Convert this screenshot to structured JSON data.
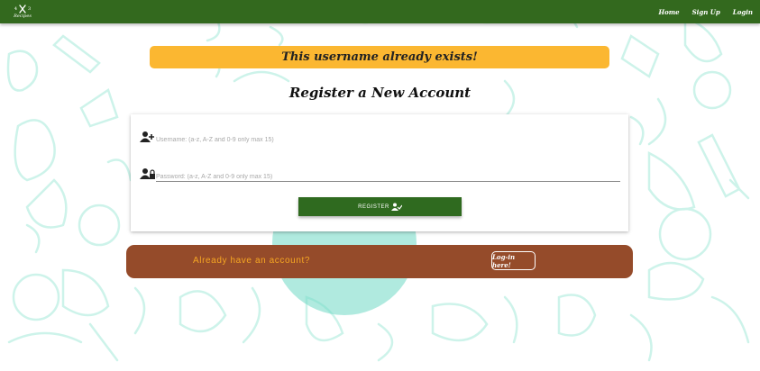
{
  "brand": {
    "number_left": "4",
    "number_right": "3",
    "name": "Recipes"
  },
  "nav": {
    "items": [
      {
        "label": "Home"
      },
      {
        "label": "Sign Up"
      },
      {
        "label": "Login"
      }
    ]
  },
  "alert": {
    "message": "This username already exists!"
  },
  "heading": "Register a New Account",
  "form": {
    "username": {
      "placeholder": "Username: (a-z, A-Z and 0-9 only max 15)",
      "value": ""
    },
    "password": {
      "placeholder": "Password: (a-z, A-Z and 0-9 only max 15)",
      "value": ""
    },
    "register_label": "Register"
  },
  "login_banner": {
    "text": "Already have an account?",
    "link_label": "Log-in here!"
  },
  "colors": {
    "navbar": "#33691e",
    "alert": "#fbb731",
    "button": "#2f6a1f",
    "banner": "#954b2a",
    "banner_text": "#f5a623",
    "pattern": "#c4f0e6"
  }
}
